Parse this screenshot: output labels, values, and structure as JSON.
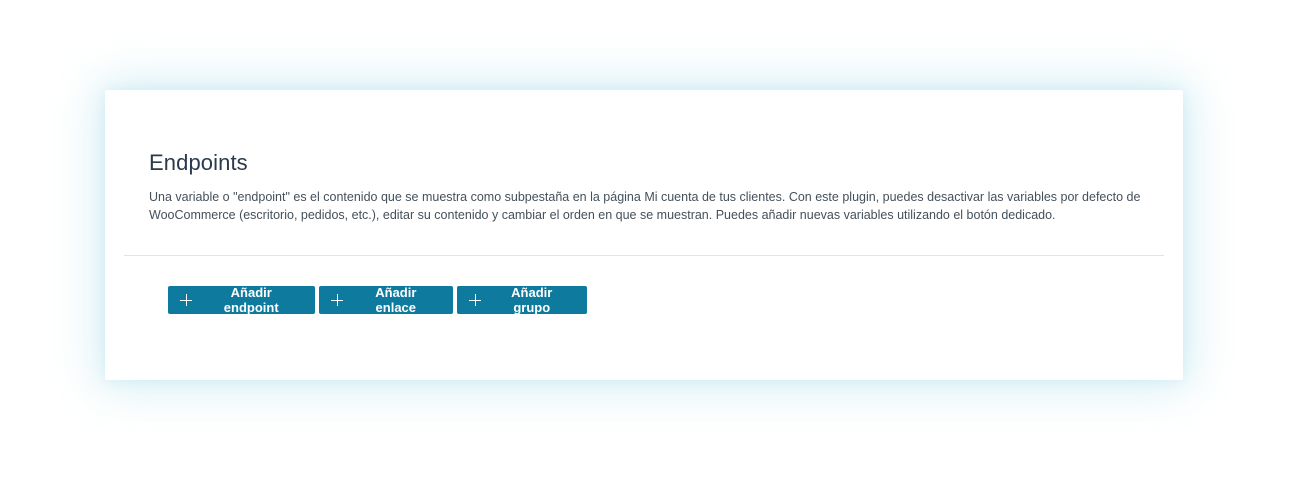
{
  "panel": {
    "title": "Endpoints",
    "description": "Una variable o \"endpoint\" es el contenido que se muestra como subpestaña en la página Mi cuenta de tus clientes. Con este plugin, puedes desactivar las variables por defecto de WooCommerce (escritorio, pedidos, etc.), editar su contenido y cambiar el orden en que se muestran. Puedes añadir nuevas variables utilizando el botón dedicado."
  },
  "actions": {
    "add_endpoint": "Añadir endpoint",
    "add_link": "Añadir enlace",
    "add_group": "Añadir grupo",
    "icon": "plus-icon"
  },
  "colors": {
    "button_bg": "#0d7a9e",
    "title_text": "#2b3a4a",
    "body_text": "#45505a",
    "card_glow": "#9cd6e6"
  }
}
